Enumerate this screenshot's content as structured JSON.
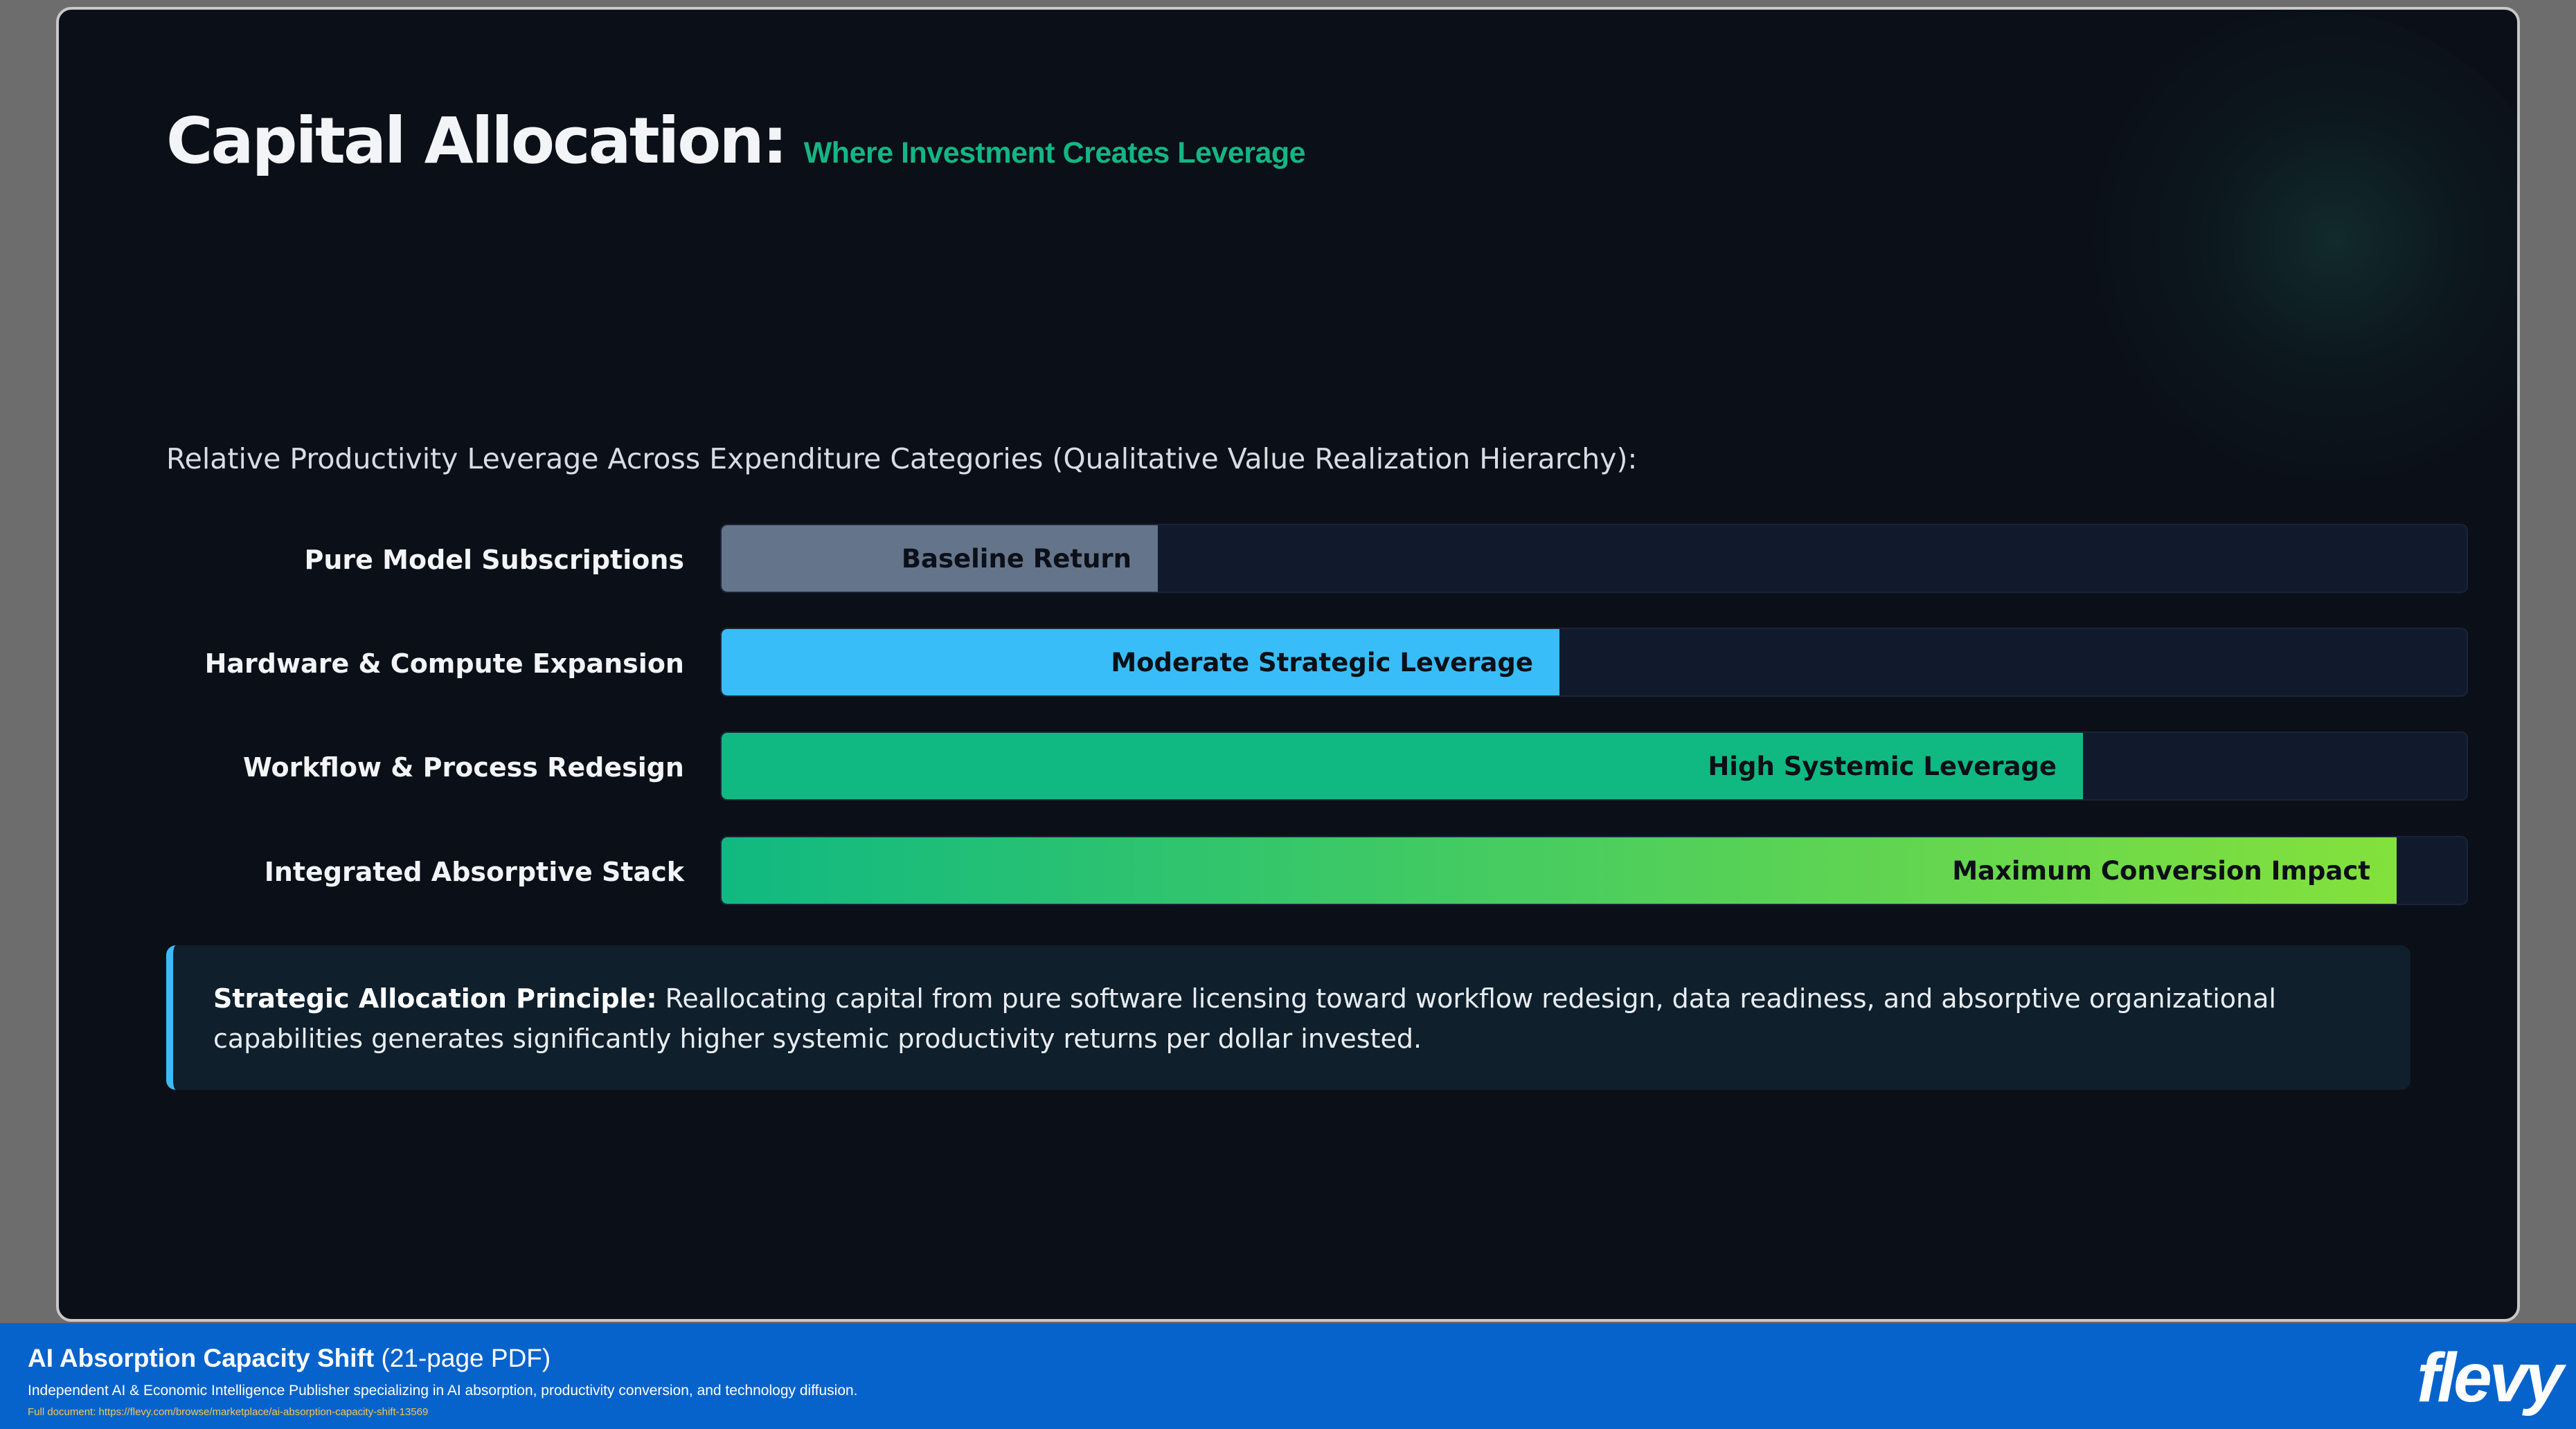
{
  "slide": {
    "title": "Capital Allocation:",
    "subtitle": "Where Investment Creates Leverage",
    "chart_caption": "Relative Productivity Leverage Across Expenditure Categories (Qualitative Value Realization Hierarchy):",
    "callout": {
      "bold": "Strategic Allocation Principle:",
      "text": " Reallocating capital from pure software licensing toward workflow redesign, data readiness, and absorptive organizational capabilities generates significantly higher systemic productivity returns per dollar invested."
    }
  },
  "chart_data": {
    "type": "bar",
    "orientation": "horizontal",
    "title": "",
    "xlabel": "",
    "ylabel": "",
    "xlim": [
      0,
      1
    ],
    "categories": [
      "Pure Model Subscriptions",
      "Hardware & Compute Expansion",
      "Workflow & Process Redesign",
      "Integrated Absorptive Stack"
    ],
    "values": [
      0.25,
      0.48,
      0.78,
      0.96
    ],
    "bar_labels": [
      "Baseline Return",
      "Moderate Strategic Leverage",
      "High Systemic Leverage",
      "Maximum Conversion Impact"
    ],
    "colors": [
      "#64748b",
      "#38bdf8",
      "#10b981",
      "gradient:#10b981-#84e13c"
    ]
  },
  "footer": {
    "title": "AI Absorption Capacity Shift",
    "pages": " (21-page PDF)",
    "description": "Independent AI & Economic Intelligence Publisher specializing in AI absorption, productivity conversion, and technology diffusion.",
    "link": "Full document: https://flevy.com/browse/marketplace/ai-absorption-capacity-shift-13569",
    "logo": "flevy"
  },
  "colors": {
    "background": "#0b0f17",
    "accent_green": "#14b684",
    "accent_blue": "#3bbcf5",
    "footer_blue": "#0763cc"
  }
}
